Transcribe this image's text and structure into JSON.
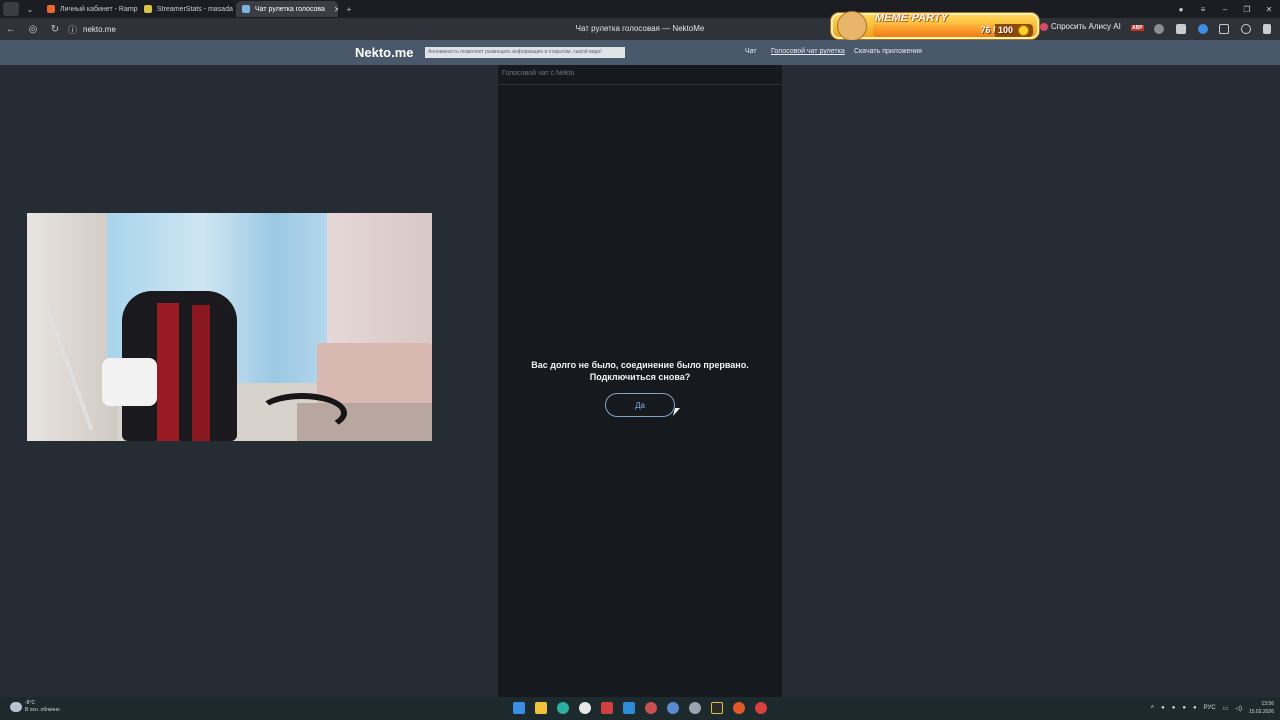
{
  "browser": {
    "tabs": [
      {
        "label": "Личный кабинет - Ramp",
        "active": false,
        "favicon_color": "#e86a2a"
      },
      {
        "label": "StreamerStats - masada",
        "active": false,
        "favicon_color": "#d8c24a"
      },
      {
        "label": "Чат рулетка голосова",
        "active": true,
        "favicon_color": "#7ab4e0"
      }
    ],
    "new_tab": "+",
    "url": "nekto.me",
    "page_title": "Чат рулетка голосовая — NektoMe",
    "alice_label": "Спросить Алису AI",
    "abp_label": "ABP"
  },
  "meme_party": {
    "title": "MEME·PARTY",
    "count": "76 / 100",
    "progress": 0.76
  },
  "site": {
    "logo": "Nekto.me",
    "notice": "Анонимность позволяет размещать информацию в открытом, сырой виде!",
    "nav": [
      {
        "label": "Чат"
      },
      {
        "label": "Голосовой чат рулетка"
      },
      {
        "label": "Скачать приложения"
      }
    ]
  },
  "chat": {
    "header": "Голосовой чат с Nekto",
    "message_line1": "Вас долго не было, соединение было прервано.",
    "message_line2": "Подключиться снова?",
    "yes_button": "Да"
  },
  "taskbar": {
    "weather_temp": "-8°C",
    "weather_desc": "В осн. облачно",
    "lang": "РУС",
    "time": "13:56",
    "date": "15.02.2026"
  }
}
